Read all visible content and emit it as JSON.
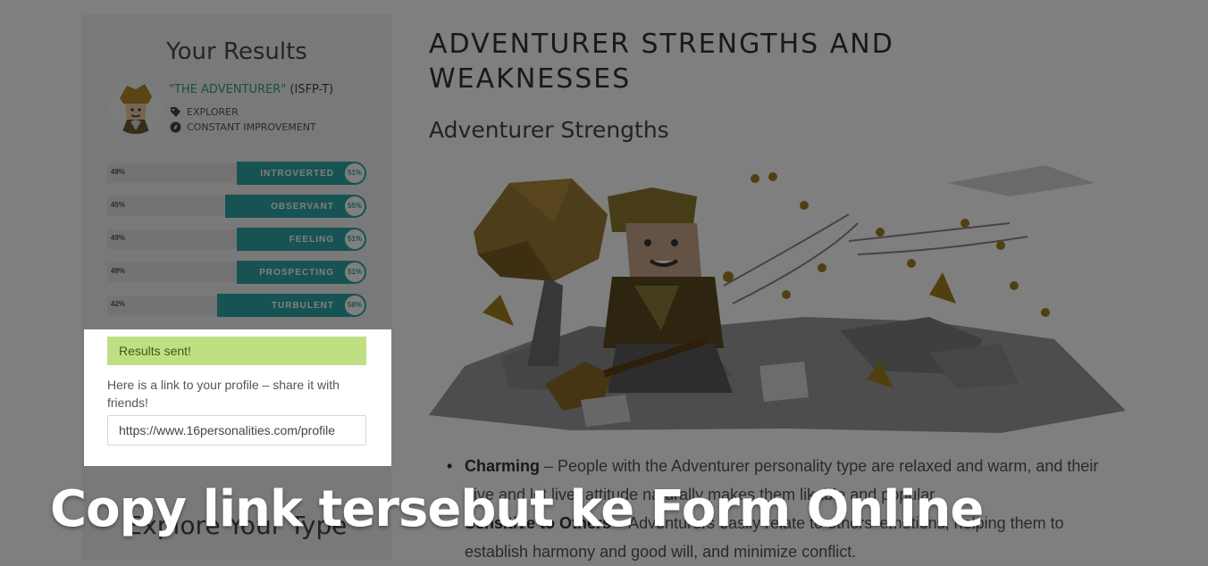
{
  "sidebar": {
    "title": "Your Results",
    "type_name": "\"THE ADVENTURER\"",
    "type_code": "(ISFP-T)",
    "roles": [
      {
        "label": "EXPLORER",
        "icon": "tag-icon"
      },
      {
        "label": "CONSTANT IMPROVEMENT",
        "icon": "compass-icon"
      }
    ],
    "traits": [
      {
        "label": "INTROVERTED",
        "left_pct": "49%",
        "pct": "51%",
        "value": 51
      },
      {
        "label": "OBSERVANT",
        "left_pct": "45%",
        "pct": "55%",
        "value": 55
      },
      {
        "label": "FEELING",
        "left_pct": "49%",
        "pct": "51%",
        "value": 51
      },
      {
        "label": "PROSPECTING",
        "left_pct": "49%",
        "pct": "51%",
        "value": 51
      },
      {
        "label": "TURBULENT",
        "left_pct": "42%",
        "pct": "58%",
        "value": 58
      }
    ],
    "explore_label": "Explore Your Type"
  },
  "popup": {
    "success_message": "Results sent!",
    "share_text": "Here is a link to your profile – share it with friends!",
    "profile_link": "https://www.16personalities.com/profile"
  },
  "main": {
    "heading": "ADVENTURER STRENGTHS AND WEAKNESSES",
    "subheading": "Adventurer Strengths",
    "bullets": [
      {
        "term": "Charming",
        "text": " – People with the Adventurer personality type are relaxed and warm, and their “live and let live” attitude naturally makes them likable and popular."
      },
      {
        "term": "Sensitive to Others",
        "text": " – Adventurers easily relate to others’ emotions, helping them to establish harmony and good will, and minimize conflict."
      }
    ]
  },
  "caption": "Copy link tersebut ke Form Online",
  "colors": {
    "accent_teal": "#30a6a6",
    "type_green": "#33a474",
    "success_bg": "#bfdf83"
  }
}
